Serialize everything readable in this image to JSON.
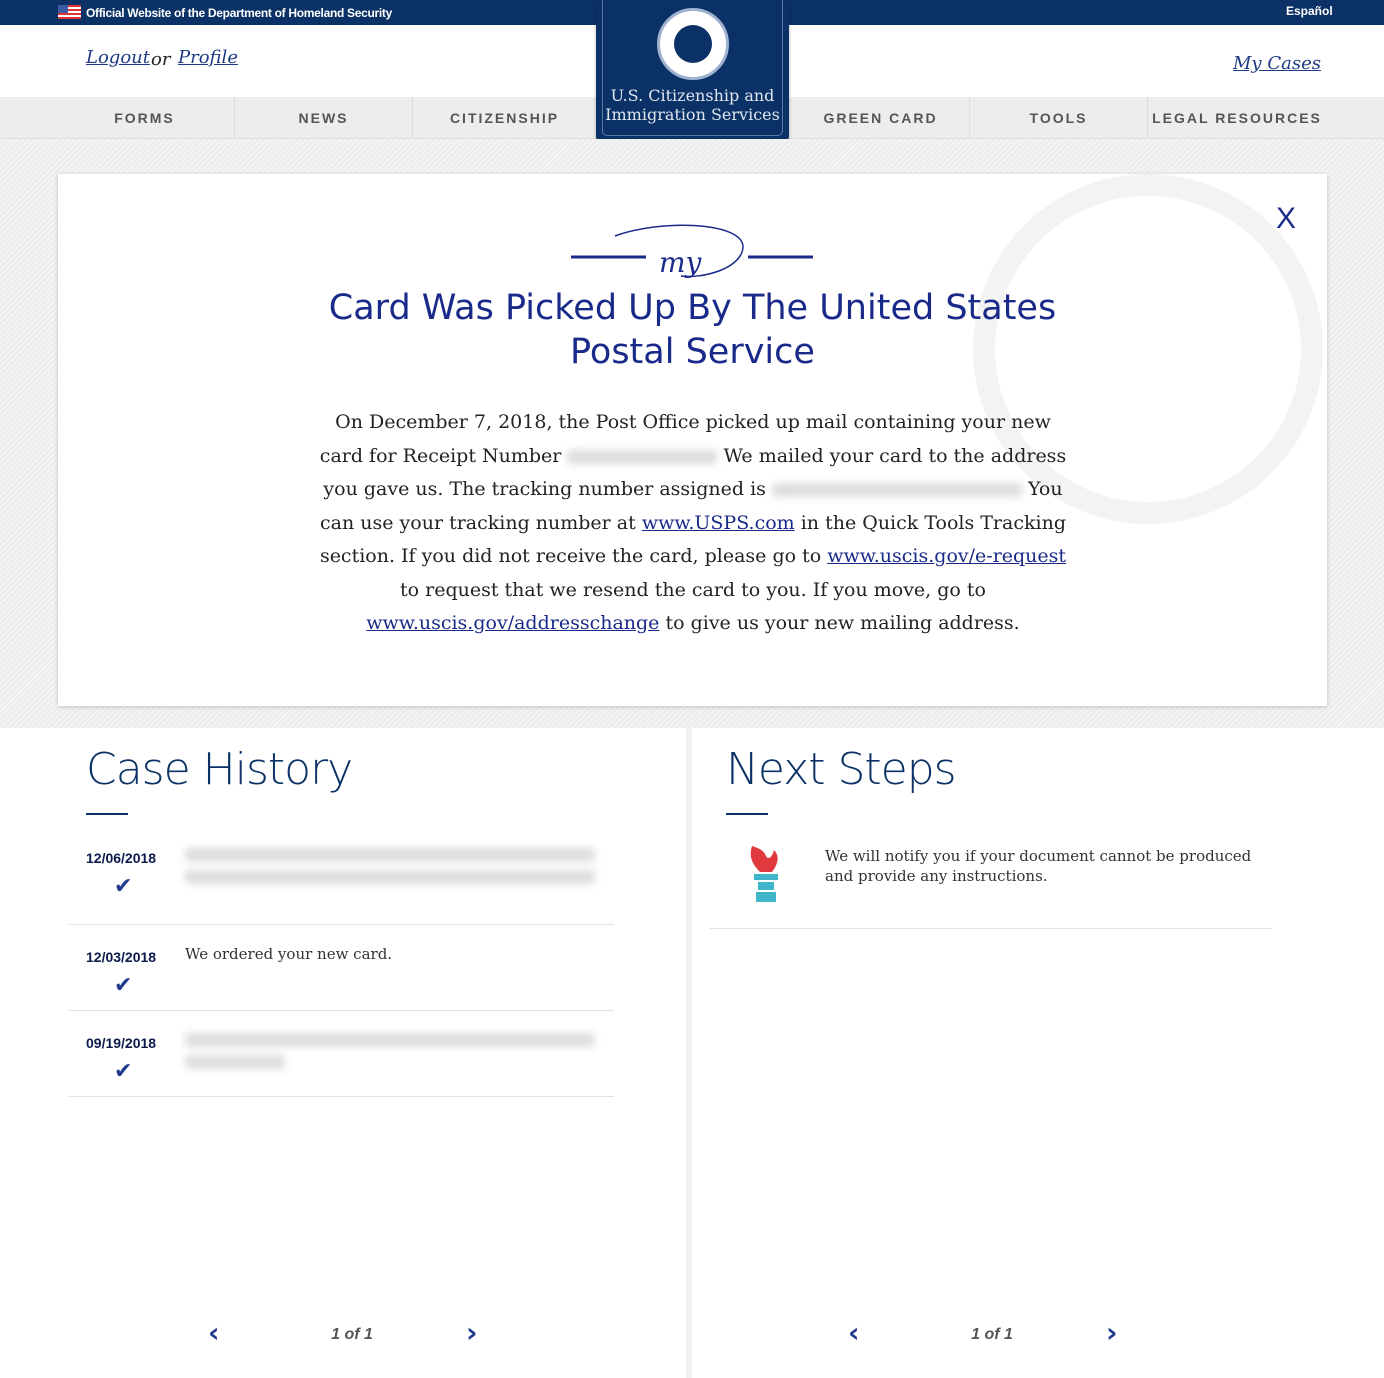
{
  "topbar": {
    "official": "Official Website of the Department of Homeland Security",
    "language": "Español"
  },
  "header": {
    "logout": "Logout",
    "or": "or",
    "profile": "Profile",
    "my_cases": "My Cases"
  },
  "logo": {
    "line1": "U.S. Citizenship and",
    "line2": "Immigration Services"
  },
  "nav": {
    "items": [
      "FORMS",
      "NEWS",
      "CITIZENSHIP",
      "GREEN CARD",
      "TOOLS",
      "LEGAL RESOURCES"
    ]
  },
  "modal": {
    "close": "X",
    "logo_text": "my",
    "title_line1": "Card Was Picked Up By The United States",
    "title_line2": "Postal Service",
    "body": {
      "p1": "On December 7, 2018, the Post Office picked up mail containing your new card for Receipt Number ",
      "p2": " We mailed your card to the address you gave us. The tracking number assigned is ",
      "p3": " You can use your tracking number at ",
      "link_usps": "www.USPS.com",
      "p4": " in the Quick Tools Tracking section. If you did not receive the card, please go to ",
      "link_erequest": "www.uscis.gov/e-request",
      "p5": " to request that we resend the card to you. If you move, go to ",
      "link_address": "www.uscis.gov/addresschange",
      "p6": " to give us your new mailing address."
    }
  },
  "case_history": {
    "title": "Case History",
    "rows": [
      {
        "date": "12/06/2018",
        "text": ""
      },
      {
        "date": "12/03/2018",
        "text": "We ordered your new card."
      },
      {
        "date": "09/19/2018",
        "text": ""
      }
    ],
    "pager": "1 of 1"
  },
  "next_steps": {
    "title": "Next Steps",
    "item": "We will notify you if your document cannot be produced and provide any instructions.",
    "icon": "torch-icon",
    "pager": "1 of 1"
  },
  "colors": {
    "navy": "#0b3266",
    "accent": "#1a2a8a",
    "torch_flame": "#e03a3e",
    "torch_base": "#3fb5c8"
  }
}
